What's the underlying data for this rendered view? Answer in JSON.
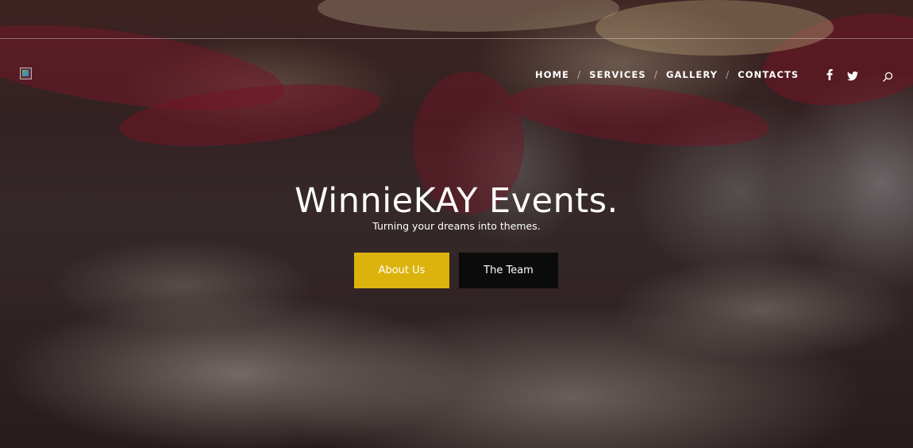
{
  "header": {
    "nav": [
      {
        "label": "HOME"
      },
      {
        "label": "SERVICES"
      },
      {
        "label": "GALLERY"
      },
      {
        "label": "CONTACTS"
      }
    ],
    "separator": "/",
    "social": [
      {
        "icon": "facebook-icon"
      },
      {
        "icon": "twitter-icon"
      }
    ],
    "search_icon": "search-icon",
    "logo_icon": "broken-image-icon"
  },
  "hero": {
    "title": "WinnieKAY Events.",
    "subtitle": "Turning your dreams into themes.",
    "buttons": {
      "about_label": "About Us",
      "team_label": "The Team"
    }
  },
  "colors": {
    "accent": "#dcb30c",
    "dark_button": "#0b0b0b",
    "text": "#ffffff"
  }
}
